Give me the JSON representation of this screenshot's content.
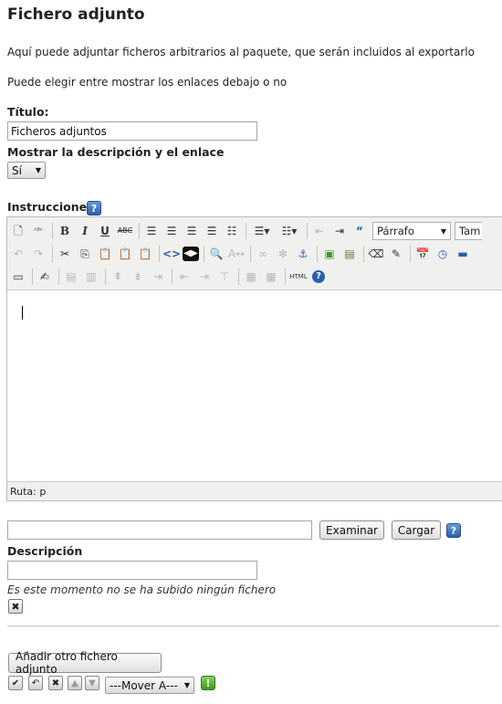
{
  "header": {
    "title": "Fichero adjunto"
  },
  "intro": {
    "line1": "Aquí puede adjuntar ficheros arbitrarios al paquete, que serán incluidos al exportarlo",
    "line2": "Puede elegir entre mostrar los enlaces debajo o no"
  },
  "titulo": {
    "label": "Título:",
    "value": "Ficheros adjuntos"
  },
  "mostrar": {
    "label": "Mostrar la descripción y el enlace",
    "selected": "Sí"
  },
  "instrucciones": {
    "label": "Instrucciones",
    "help_icon": "question-icon"
  },
  "editor": {
    "format_select": "Párrafo",
    "size_select": "Tam",
    "bold": "B",
    "italic": "I",
    "underline": "U",
    "strike": "ABC",
    "html_label": "HTML",
    "status_text": "Ruta: p"
  },
  "upload": {
    "file_value": "",
    "browse_label": "Examinar",
    "upload_label": "Cargar"
  },
  "descripcion": {
    "label": "Descripción",
    "value": ""
  },
  "status_note": "Es este momento no se ha subido ningún fichero",
  "add_button": "Añadir otro fichero adjunto",
  "move_select": "---Mover A---",
  "colors": {
    "help_blue": "#2a5faa",
    "info_green": "#3c9a1b",
    "toolbar_bg": "#f0f0ee"
  }
}
